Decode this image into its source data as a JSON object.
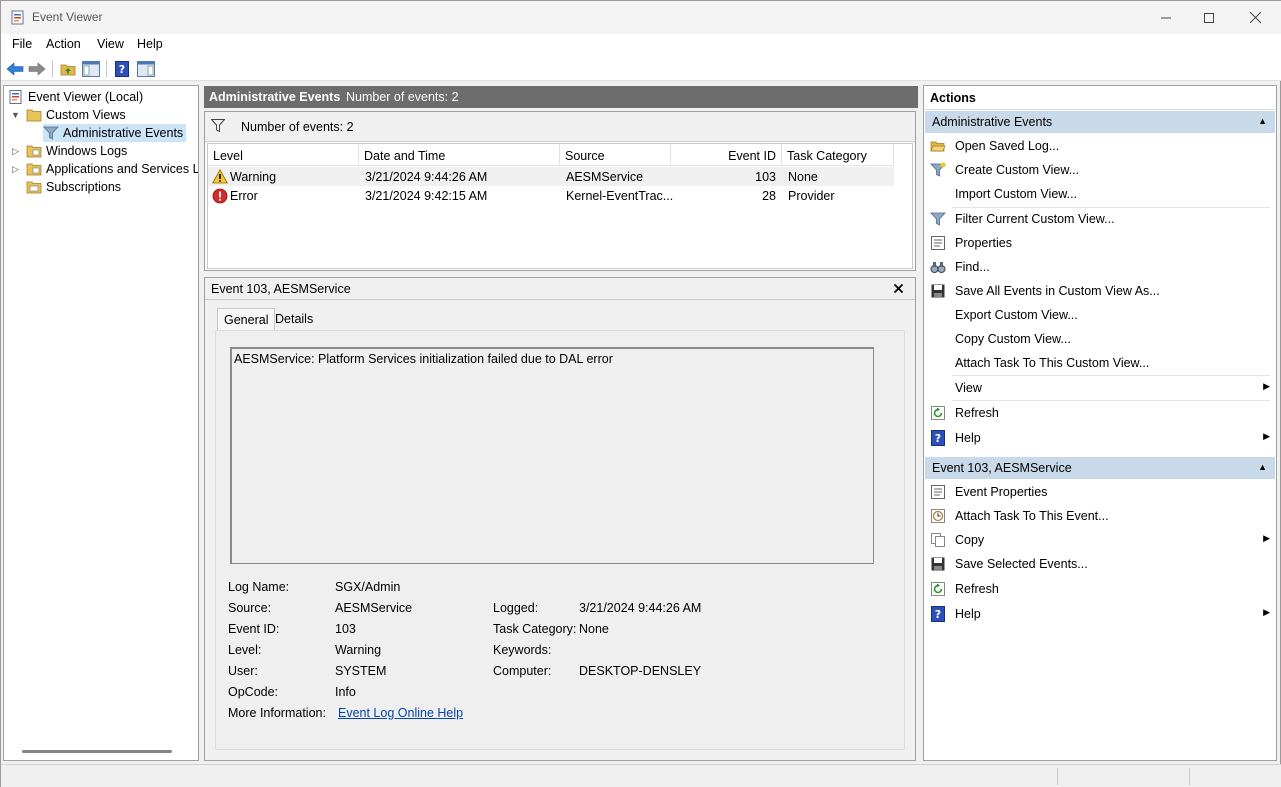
{
  "window": {
    "title": "Event Viewer"
  },
  "menu": [
    "File",
    "Action",
    "View",
    "Help"
  ],
  "tree": {
    "root": "Event Viewer (Local)",
    "custom_views": "Custom Views",
    "admin_events": "Administrative Events",
    "windows_logs": "Windows Logs",
    "apps_services": "Applications and Services Lo",
    "subscriptions": "Subscriptions"
  },
  "center": {
    "title": "Administrative Events",
    "count_label": "Number of events: 2",
    "filter_label": "Number of events: 2",
    "columns": [
      "Level",
      "Date and Time",
      "Source",
      "Event ID",
      "Task Category"
    ],
    "rows": [
      {
        "level": "Warning",
        "datetime": "3/21/2024 9:44:26 AM",
        "source": "AESMService",
        "event_id": "103",
        "category": "None"
      },
      {
        "level": "Error",
        "datetime": "3/21/2024 9:42:15 AM",
        "source": "Kernel-EventTrac...",
        "event_id": "28",
        "category": "Provider"
      }
    ]
  },
  "detail": {
    "title": "Event 103, AESMService",
    "tabs": [
      "General",
      "Details"
    ],
    "message": "AESMService: Platform Services initialization failed due to DAL error",
    "fields": {
      "log_name_label": "Log Name:",
      "log_name": "SGX/Admin",
      "source_label": "Source:",
      "source": "AESMService",
      "logged_label": "Logged:",
      "logged": "3/21/2024 9:44:26 AM",
      "event_id_label": "Event ID:",
      "event_id": "103",
      "task_category_label": "Task Category:",
      "task_category": "None",
      "level_label": "Level:",
      "level": "Warning",
      "keywords_label": "Keywords:",
      "user_label": "User:",
      "user": "SYSTEM",
      "computer_label": "Computer:",
      "computer": "DESKTOP-DENSLEY",
      "opcode_label": "OpCode:",
      "opcode": "Info",
      "more_info_label": "More Information:",
      "more_info_link": "Event Log Online Help"
    }
  },
  "actions": {
    "title": "Actions",
    "section1": "Administrative Events",
    "section1_items": [
      "Open Saved Log...",
      "Create Custom View...",
      "Import Custom View...",
      "Filter Current Custom View...",
      "Properties",
      "Find...",
      "Save All Events in Custom View As...",
      "Export Custom View...",
      "Copy Custom View...",
      "Attach Task To This Custom View...",
      "View",
      "Refresh",
      "Help"
    ],
    "section2": "Event 103, AESMService",
    "section2_items": [
      "Event Properties",
      "Attach Task To This Event...",
      "Copy",
      "Save Selected Events...",
      "Refresh",
      "Help"
    ]
  },
  "colors": {
    "section_header": "#c8d9ea",
    "center_header": "#6d6d6d",
    "selection": "#cce4f7",
    "link": "#0645ad"
  }
}
